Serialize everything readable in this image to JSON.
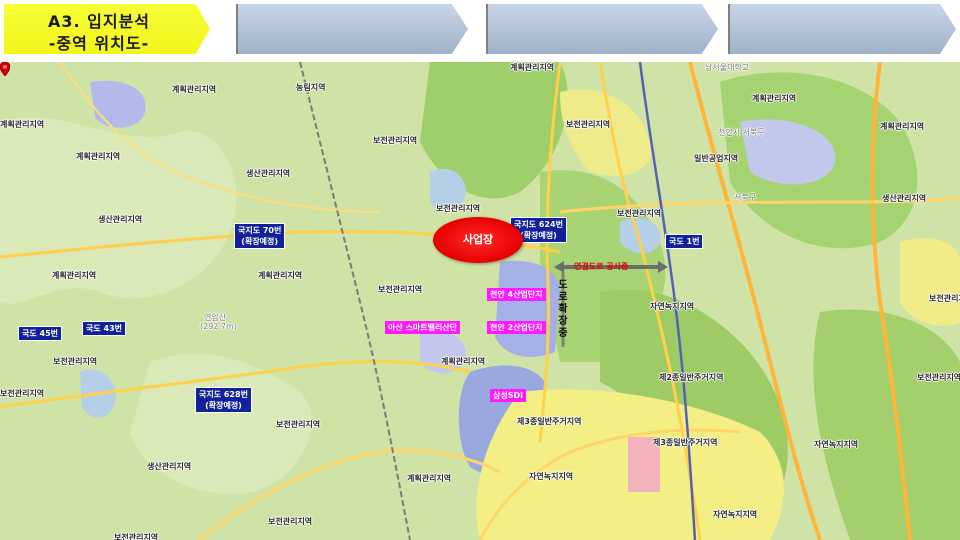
{
  "header": {
    "title_line1": "A3. 입지분석",
    "title_line2": "-중역 위치도-"
  },
  "map": {
    "site": {
      "label": "사업장"
    },
    "road_tags": [
      {
        "id": "gukji70",
        "line1": "국지도 70번",
        "line2": "(확장예정)"
      },
      {
        "id": "gukji624",
        "line1": "국지도 624번",
        "line2": "(확장예정)"
      },
      {
        "id": "gukji628",
        "line1": "국지도 628번",
        "line2": "(확장예정)"
      },
      {
        "id": "gukdo1",
        "line1": "국도 1번",
        "line2": ""
      },
      {
        "id": "gukdo45",
        "line1": "국도 45번",
        "line2": ""
      },
      {
        "id": "gukdo43",
        "line1": "국도 43번",
        "line2": ""
      }
    ],
    "industrial_tags": [
      {
        "id": "ind4",
        "label": "천안 4산업단지"
      },
      {
        "id": "ind2",
        "label": "천안 2산업단지"
      },
      {
        "id": "asan",
        "label": "아산 스마트밸리산단"
      },
      {
        "id": "sdi",
        "label": "삼성SDI"
      }
    ],
    "connector_label": "연결도로 공사중",
    "vertical_label": [
      "도",
      "로",
      "확",
      "장",
      "중"
    ],
    "zone_labels": [
      "계획관리지역",
      "농림지역",
      "계획관리지역",
      "계획관리지역",
      "남서울대학교",
      "계획관리지역",
      "계획관리지역",
      "보전관리지역",
      "천안시 서북구",
      "보전관리지역",
      "계획관리지역",
      "생산관리지역",
      "일반공업지역",
      "보전관리지역",
      "생산관리지역",
      "생산관리지역",
      "보전관리지역",
      "계획관리지역",
      "계획관리지역",
      "보전관리지역",
      "자연녹지지역",
      "보전관리지역",
      "연암산",
      "(292.7m)",
      "보전관리지역",
      "제2종일반주거지역",
      "보전관리지역",
      "보전관리지역",
      "계획관리지역",
      "제3종일반주거지역",
      "보전관리지역",
      "제3종일반주거지역",
      "자연녹지지역",
      "생산관리지역",
      "자연녹지지역",
      "계획관리지역",
      "자연녹지지역",
      "보전관리지역",
      "보전관리지역",
      "서북구"
    ]
  }
}
